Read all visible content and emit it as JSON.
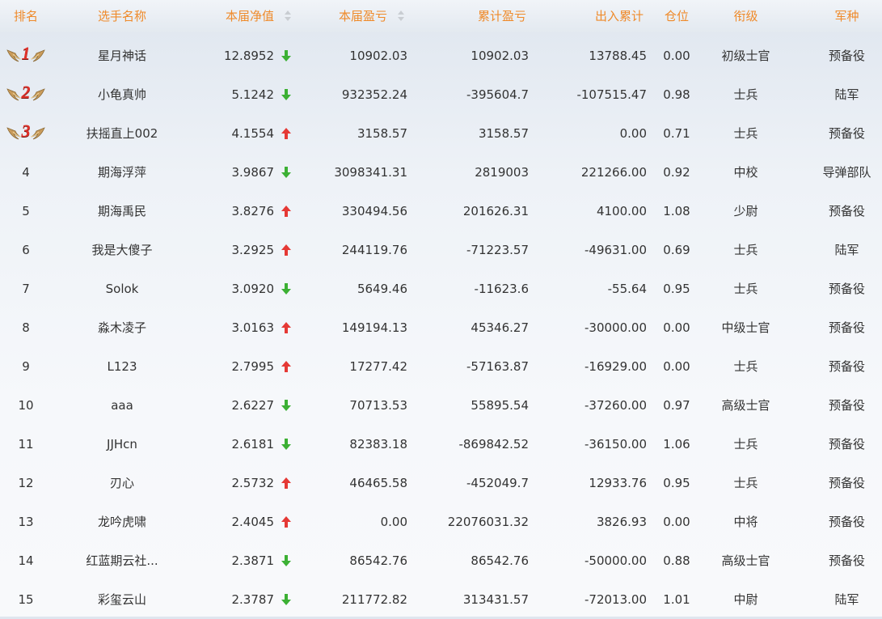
{
  "colors": {
    "header_text": "#ef8a2a",
    "up_arrow": "#e53935",
    "down_arrow": "#3cb034",
    "medal_wing": "#c99b5b",
    "medal_number": "#e0312a"
  },
  "table": {
    "headers": {
      "rank": "排名",
      "player": "选手名称",
      "current_nav": "本届净值",
      "current_pnl": "本届盈亏",
      "total_pnl": "累计盈亏",
      "cumulative_flow": "出入累计",
      "position": "仓位",
      "rank_title": "衔级",
      "branch": "军种"
    },
    "rows": [
      {
        "rank": "1",
        "medal": "gold-wing-medal-icon",
        "player": "星月神话",
        "current_nav": "12.8952",
        "trend": "down",
        "current_pnl": "10902.03",
        "total_pnl": "10902.03",
        "cumulative_flow": "13788.45",
        "position": "0.00",
        "rank_title": "初级士官",
        "branch": "预备役"
      },
      {
        "rank": "2",
        "medal": "gold-wing-medal-icon",
        "player": "小龟真帅",
        "current_nav": "5.1242",
        "trend": "down",
        "current_pnl": "932352.24",
        "total_pnl": "-395604.7",
        "cumulative_flow": "-107515.47",
        "position": "0.98",
        "rank_title": "士兵",
        "branch": "陆军"
      },
      {
        "rank": "3",
        "medal": "gold-wing-medal-icon",
        "player": "扶摇直上002",
        "current_nav": "4.1554",
        "trend": "up",
        "current_pnl": "3158.57",
        "total_pnl": "3158.57",
        "cumulative_flow": "0.00",
        "position": "0.71",
        "rank_title": "士兵",
        "branch": "预备役"
      },
      {
        "rank": "4",
        "player": "期海浮萍",
        "current_nav": "3.9867",
        "trend": "down",
        "current_pnl": "3098341.31",
        "total_pnl": "2819003",
        "cumulative_flow": "221266.00",
        "position": "0.92",
        "rank_title": "中校",
        "branch": "导弹部队"
      },
      {
        "rank": "5",
        "player": "期海禹民",
        "current_nav": "3.8276",
        "trend": "up",
        "current_pnl": "330494.56",
        "total_pnl": "201626.31",
        "cumulative_flow": "4100.00",
        "position": "1.08",
        "rank_title": "少尉",
        "branch": "预备役"
      },
      {
        "rank": "6",
        "player": "我是大傻子",
        "current_nav": "3.2925",
        "trend": "up",
        "current_pnl": "244119.76",
        "total_pnl": "-71223.57",
        "cumulative_flow": "-49631.00",
        "position": "0.69",
        "rank_title": "士兵",
        "branch": "陆军"
      },
      {
        "rank": "7",
        "player": "Solok",
        "current_nav": "3.0920",
        "trend": "down",
        "current_pnl": "5649.46",
        "total_pnl": "-11623.6",
        "cumulative_flow": "-55.64",
        "position": "0.95",
        "rank_title": "士兵",
        "branch": "预备役"
      },
      {
        "rank": "8",
        "player": "淼木凌子",
        "current_nav": "3.0163",
        "trend": "up",
        "current_pnl": "149194.13",
        "total_pnl": "45346.27",
        "cumulative_flow": "-30000.00",
        "position": "0.00",
        "rank_title": "中级士官",
        "branch": "预备役"
      },
      {
        "rank": "9",
        "player": "L123",
        "current_nav": "2.7995",
        "trend": "up",
        "current_pnl": "17277.42",
        "total_pnl": "-57163.87",
        "cumulative_flow": "-16929.00",
        "position": "0.00",
        "rank_title": "士兵",
        "branch": "预备役"
      },
      {
        "rank": "10",
        "player": "aaa",
        "current_nav": "2.6227",
        "trend": "down",
        "current_pnl": "70713.53",
        "total_pnl": "55895.54",
        "cumulative_flow": "-37260.00",
        "position": "0.97",
        "rank_title": "高级士官",
        "branch": "预备役"
      },
      {
        "rank": "11",
        "player": "JJHcn",
        "current_nav": "2.6181",
        "trend": "down",
        "current_pnl": "82383.18",
        "total_pnl": "-869842.52",
        "cumulative_flow": "-36150.00",
        "position": "1.06",
        "rank_title": "士兵",
        "branch": "预备役"
      },
      {
        "rank": "12",
        "player": "刃心",
        "current_nav": "2.5732",
        "trend": "up",
        "current_pnl": "46465.58",
        "total_pnl": "-452049.7",
        "cumulative_flow": "12933.76",
        "position": "0.95",
        "rank_title": "士兵",
        "branch": "预备役"
      },
      {
        "rank": "13",
        "player": "龙吟虎啸",
        "current_nav": "2.4045",
        "trend": "up",
        "current_pnl": "0.00",
        "total_pnl": "22076031.32",
        "cumulative_flow": "3826.93",
        "position": "0.00",
        "rank_title": "中将",
        "branch": "预备役"
      },
      {
        "rank": "14",
        "player": "红蓝期云社...",
        "current_nav": "2.3871",
        "trend": "down",
        "current_pnl": "86542.76",
        "total_pnl": "86542.76",
        "cumulative_flow": "-50000.00",
        "position": "0.88",
        "rank_title": "高级士官",
        "branch": "预备役"
      },
      {
        "rank": "15",
        "player": "彩玺云山",
        "current_nav": "2.3787",
        "trend": "down",
        "current_pnl": "211772.82",
        "total_pnl": "313431.57",
        "cumulative_flow": "-72013.00",
        "position": "1.01",
        "rank_title": "中尉",
        "branch": "陆军"
      }
    ]
  }
}
